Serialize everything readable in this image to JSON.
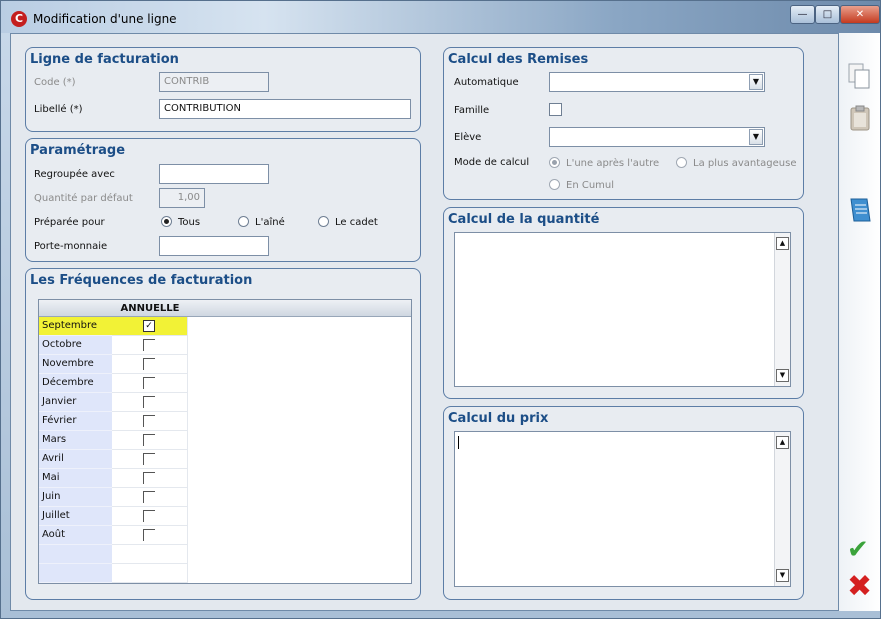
{
  "window": {
    "title": "Modification d'une ligne",
    "app_icon": "C",
    "controls": {
      "minimize": "—",
      "maximize": "□",
      "close": "✕"
    }
  },
  "ligne": {
    "title": "Ligne de facturation",
    "code_label": "Code (*)",
    "code_value": "CONTRIB",
    "libelle_label": "Libellé (*)",
    "libelle_value": "CONTRIBUTION"
  },
  "parametrage": {
    "title": "Paramétrage",
    "regroupee_label": "Regroupée avec",
    "regroupee_value": "",
    "quantite_label": "Quantité par défaut",
    "quantite_value": "1,00",
    "preparee_label": "Préparée pour",
    "options": [
      "Tous",
      "L'aîné",
      "Le cadet"
    ],
    "selected_option": "Tous",
    "porte_monnaie_label": "Porte-monnaie",
    "porte_monnaie_value": ""
  },
  "frequences": {
    "title": "Les Fréquences de facturation",
    "column": "ANNUELLE",
    "months": [
      {
        "name": "Septembre",
        "checked": true,
        "check_mark": "✓"
      },
      {
        "name": "Octobre",
        "checked": false
      },
      {
        "name": "Novembre",
        "checked": false
      },
      {
        "name": "Décembre",
        "checked": false
      },
      {
        "name": "Janvier",
        "checked": false
      },
      {
        "name": "Février",
        "checked": false
      },
      {
        "name": "Mars",
        "checked": false
      },
      {
        "name": "Avril",
        "checked": false
      },
      {
        "name": "Mai",
        "checked": false
      },
      {
        "name": "Juin",
        "checked": false
      },
      {
        "name": "Juillet",
        "checked": false
      },
      {
        "name": "Août",
        "checked": false
      }
    ],
    "selected_row": "Septembre"
  },
  "remises": {
    "title": "Calcul des Remises",
    "automatique_label": "Automatique",
    "automatique_value": "",
    "famille_label": "Famille",
    "famille_checked": false,
    "eleve_label": "Elève",
    "eleve_value": "",
    "mode_label": "Mode de calcul",
    "mode_options": [
      "L'une après l'autre",
      "La plus avantageuse",
      "En Cumul"
    ],
    "mode_selected": "L'une après l'autre",
    "dropdown_glyph": "▼"
  },
  "quantite": {
    "title": "Calcul de la quantité",
    "text": ""
  },
  "prix": {
    "title": "Calcul du prix",
    "text": ""
  },
  "scroll_glyphs": {
    "up": "▲",
    "down": "▼"
  },
  "toolbar": {
    "icons": [
      "copy-icon",
      "paste-icon",
      "notes-icon",
      "ok-icon",
      "cancel-icon"
    ],
    "ok_glyph": "✔",
    "cancel_glyph": "✖"
  },
  "colors": {
    "accent": "#1c4e87",
    "selection": "#f2f236",
    "ok": "#3ba33b",
    "cancel": "#d42020"
  }
}
